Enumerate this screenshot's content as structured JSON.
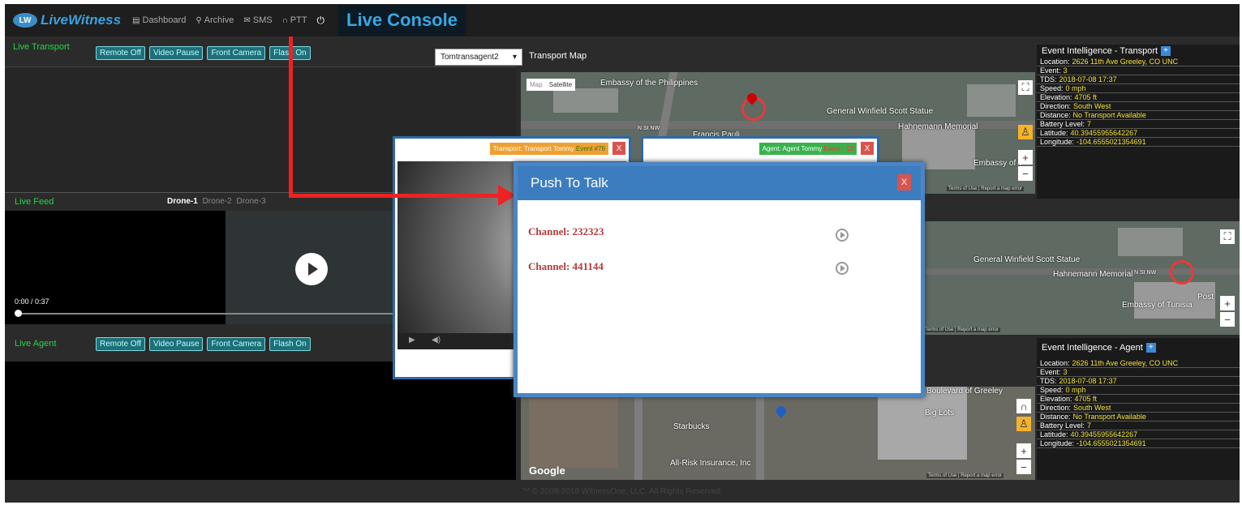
{
  "header": {
    "logo_text": "LiveWitness",
    "nav": [
      {
        "label": "Dashboard",
        "icon": "dashboard-icon"
      },
      {
        "label": "Archive",
        "icon": "map-pin-icon"
      },
      {
        "label": "SMS",
        "icon": "envelope-icon"
      },
      {
        "label": "PTT",
        "icon": "headset-icon"
      }
    ],
    "title": "Live Console"
  },
  "live_transport": {
    "label": "Live Transport",
    "buttons": [
      "Remote Off",
      "Video Pause",
      "Front Camera",
      "Flash On"
    ],
    "select_value": "Tomtransagent2"
  },
  "transport_map": {
    "title": "Transport Map",
    "map_type": [
      "Map",
      "Satellite"
    ],
    "labels": [
      "Embassy of the Philippines",
      "General Winfield Scott Statue",
      "Hahnemann Memorial",
      "N St NW",
      "Embassy of T",
      "Francis Pauli"
    ]
  },
  "live_feed": {
    "label": "Live Feed",
    "drones": [
      "Drone-1",
      "Drone-2",
      "Drone-3"
    ],
    "time": "0:00 / 0:37"
  },
  "live_agent": {
    "label": "Live Agent",
    "buttons": [
      "Remote Off",
      "Video Pause",
      "Front Camera",
      "Flash On"
    ]
  },
  "event_transport": {
    "title": "Event Intelligence - Transport",
    "rows": [
      {
        "k": "Location:",
        "v": "2626 11th Ave Greeley, CO UNC"
      },
      {
        "k": "Event:",
        "v": "3"
      },
      {
        "k": "TDS:",
        "v": "2018-07-08 17:37"
      },
      {
        "k": "Speed:",
        "v": "0 mph"
      },
      {
        "k": "Elevation:",
        "v": "4705 ft"
      },
      {
        "k": "Direction:",
        "v": "South West"
      },
      {
        "k": "Distance:",
        "v": "No Transport Available"
      },
      {
        "k": "Battery Level:",
        "v": "7"
      },
      {
        "k": "Latitude:",
        "v": "40.39455955642267"
      },
      {
        "k": "Longitude:",
        "v": "-104.6555021354691"
      }
    ]
  },
  "event_agent": {
    "title": "Event Intelligence - Agent",
    "rows": [
      {
        "k": "Location:",
        "v": "2626 11th Ave Greeley, CO UNC"
      },
      {
        "k": "Event:",
        "v": "3"
      },
      {
        "k": "TDS:",
        "v": "2018-07-08 17:37"
      },
      {
        "k": "Speed:",
        "v": "0 mph"
      },
      {
        "k": "Elevation:",
        "v": "4705 ft"
      },
      {
        "k": "Direction:",
        "v": "South West"
      },
      {
        "k": "Distance:",
        "v": "No Transport Available"
      },
      {
        "k": "Battery Level:",
        "v": "7"
      },
      {
        "k": "Latitude:",
        "v": "40.39455955642267"
      },
      {
        "k": "Longitude:",
        "v": "-104.6555021354691"
      }
    ]
  },
  "transport_popup": {
    "name": "Transport: Transport Tommy",
    "event": "Event #76",
    "close": "X"
  },
  "agent_popup": {
    "name": "Agent: Agent Tommy",
    "event": "Event - 13",
    "close": "X"
  },
  "ptt": {
    "title": "Push To Talk",
    "close": "X",
    "channels": [
      "Channel:  232323",
      "Channel:  441144"
    ]
  },
  "agent_map": {
    "labels": [
      "Starbucks",
      "All-Risk Insurance, Inc",
      "Big Lots",
      "Boulevard of Greeley"
    ],
    "google": "Google"
  },
  "map2": {
    "labels": [
      "General Winfield Scott Statue",
      "Hahnemann Memorial",
      "N St NW",
      "Embassy of Tunisia",
      "Post"
    ]
  },
  "footer": {
    "text": "™ © 2008-2018 WitnessOne, LLC. All Rights Reserved."
  },
  "map_attr": {
    "terms": "Terms of Use",
    "report": "Report a map error"
  }
}
